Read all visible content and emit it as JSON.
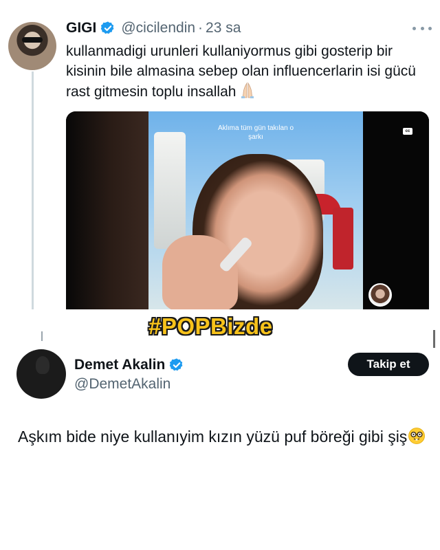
{
  "original_tweet": {
    "display_name": "GIGI",
    "handle": "@cicilendin",
    "separator": "·",
    "time": "23 sa",
    "text": "kullanmadigi urunleri kullaniyormus gibi gosterip bir kisinin bile almasina sebep olan influencerlarin isi gücü rast gitmesin toplu insallah",
    "verified_icon": "verified-badge-icon",
    "more_icon": "more-options-icon",
    "emoji": "folded-hands-icon",
    "media": {
      "caption": "Aklıma tüm gün takılan o şarkı",
      "cc_label": "cc"
    }
  },
  "overlay": {
    "hashtag": "#POPBizde",
    "hashtag_color": "#f7c21a"
  },
  "reply_tweet": {
    "display_name": "Demet Akalin",
    "handle": "@DemetAkalin",
    "follow_label": "Takip et",
    "text": "Aşkım bide niye kullanıyim kızın yüzü puf böreği gibi şiş",
    "emoji": "nerd-face-icon"
  },
  "colors": {
    "verified_blue": "#1d9bf0",
    "text_primary": "#0f1419",
    "text_secondary": "#536471",
    "button_bg": "#0f1419"
  }
}
